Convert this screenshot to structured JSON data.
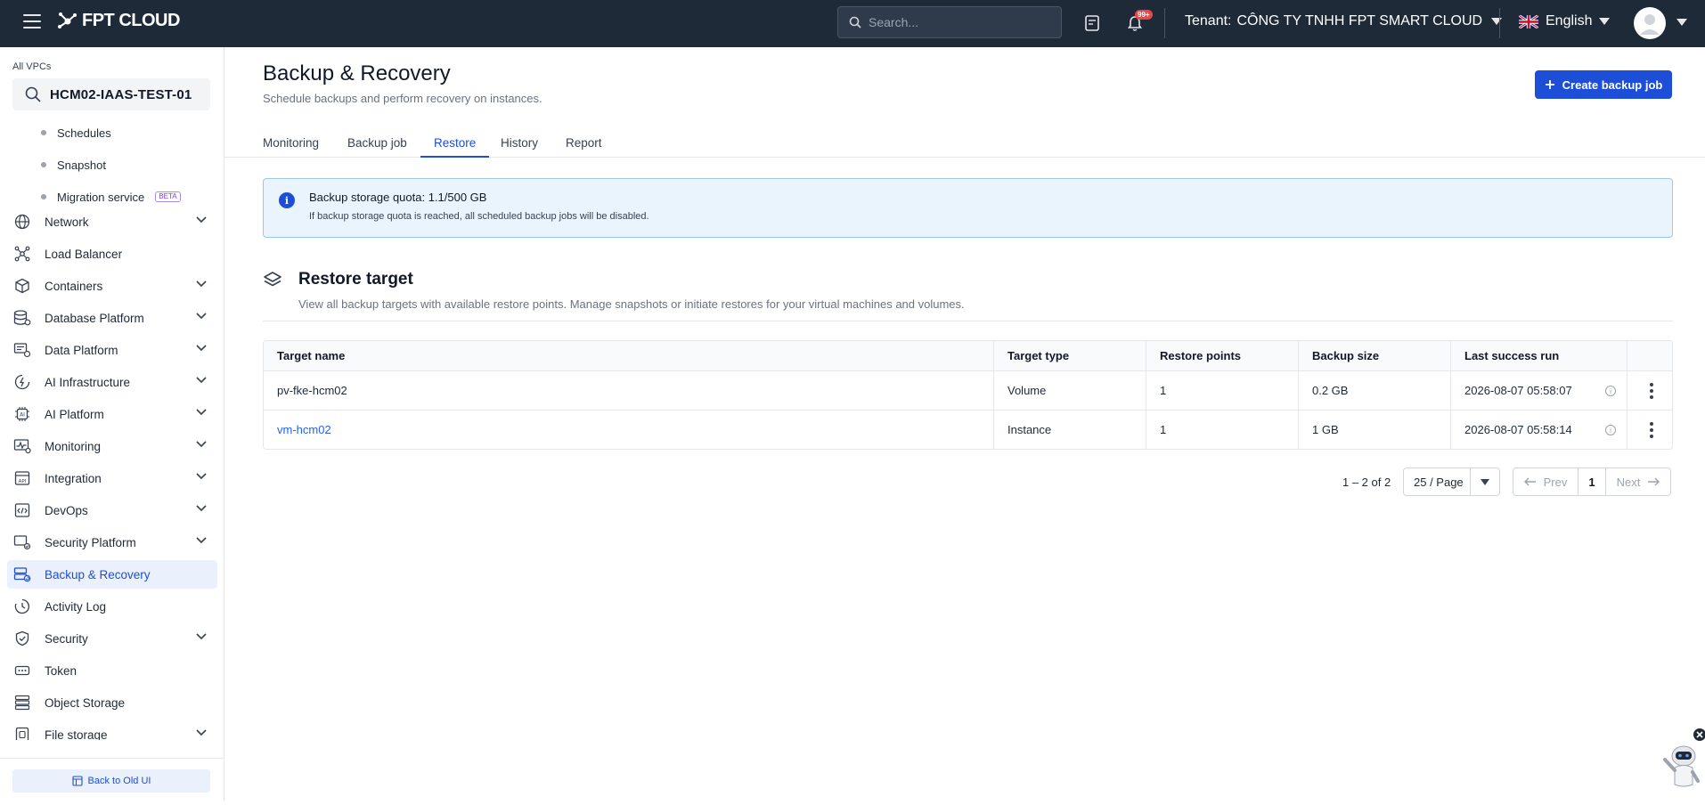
{
  "topbar": {
    "logo_text": "FPT CLOUD",
    "search_placeholder": "Search...",
    "notification_badge": "99+",
    "tenant_label": "Tenant:",
    "tenant_name": "CÔNG TY TNHH FPT SMART CLOUD",
    "language": "English"
  },
  "sidebar": {
    "vpc_label": "All VPCs",
    "vpc_name": "HCM02-IAAS-TEST-01",
    "sub_items": [
      {
        "label": "Schedules"
      },
      {
        "label": "Snapshot"
      },
      {
        "label": "Migration service",
        "badge": "BETA"
      }
    ],
    "items": [
      {
        "label": "Network",
        "icon": "globe-icon",
        "chevron": true
      },
      {
        "label": "Load Balancer",
        "icon": "load-balancer-icon",
        "chevron": false
      },
      {
        "label": "Containers",
        "icon": "cube-icon",
        "chevron": true
      },
      {
        "label": "Database Platform",
        "icon": "database-icon",
        "chevron": true
      },
      {
        "label": "Data Platform",
        "icon": "data-platform-icon",
        "chevron": true
      },
      {
        "label": "AI Infrastructure",
        "icon": "ai-infra-icon",
        "chevron": true
      },
      {
        "label": "AI Platform",
        "icon": "ai-chip-icon",
        "chevron": true
      },
      {
        "label": "Monitoring",
        "icon": "monitor-icon",
        "chevron": true
      },
      {
        "label": "Integration",
        "icon": "api-icon",
        "chevron": true
      },
      {
        "label": "DevOps",
        "icon": "devops-icon",
        "chevron": true
      },
      {
        "label": "Security Platform",
        "icon": "security-platform-icon",
        "chevron": true
      },
      {
        "label": "Backup & Recovery",
        "icon": "backup-icon",
        "chevron": false,
        "active": true
      },
      {
        "label": "Activity Log",
        "icon": "clock-icon",
        "chevron": false
      },
      {
        "label": "Security",
        "icon": "shield-icon",
        "chevron": true
      },
      {
        "label": "Token",
        "icon": "token-icon",
        "chevron": false
      },
      {
        "label": "Object Storage",
        "icon": "object-storage-icon",
        "chevron": false
      },
      {
        "label": "File storage",
        "icon": "file-storage-icon",
        "chevron": true
      }
    ],
    "back_to_old_ui": "Back to Old UI"
  },
  "main": {
    "title": "Backup & Recovery",
    "subtitle": "Schedule backups and perform recovery on instances.",
    "create_button": "Create backup job",
    "tabs": [
      {
        "label": "Monitoring"
      },
      {
        "label": "Backup job"
      },
      {
        "label": "Restore",
        "active": true
      },
      {
        "label": "History"
      },
      {
        "label": "Report"
      }
    ],
    "info": {
      "title": "Backup storage quota: 1.1/500 GB",
      "description": "If backup storage quota is reached, all scheduled backup jobs will be disabled."
    },
    "section": {
      "title": "Restore target",
      "subtitle": "View all backup targets with available restore points. Manage snapshots or initiate restores for your virtual machines and volumes."
    },
    "table": {
      "columns": [
        "Target name",
        "Target type",
        "Restore points",
        "Backup size",
        "Last success run"
      ],
      "rows": [
        {
          "name": "pv-fke-hcm02",
          "link": false,
          "type": "Volume",
          "restore_points": "1",
          "size": "0.2 GB",
          "last_run": "2026-08-07 05:58:07"
        },
        {
          "name": "vm-hcm02",
          "link": true,
          "type": "Instance",
          "restore_points": "1",
          "size": "1 GB",
          "last_run": "2026-08-07 05:58:14"
        }
      ]
    },
    "pagination": {
      "count": "1 – 2 of 2",
      "per_page": "25 / Page",
      "prev": "Prev",
      "current": "1",
      "next": "Next"
    }
  },
  "colors": {
    "topbar_bg": "#1f2a38",
    "accent": "#1d4ed8",
    "info_bg": "#eaf4fd",
    "active_nav_bg": "#eaf1fc"
  }
}
